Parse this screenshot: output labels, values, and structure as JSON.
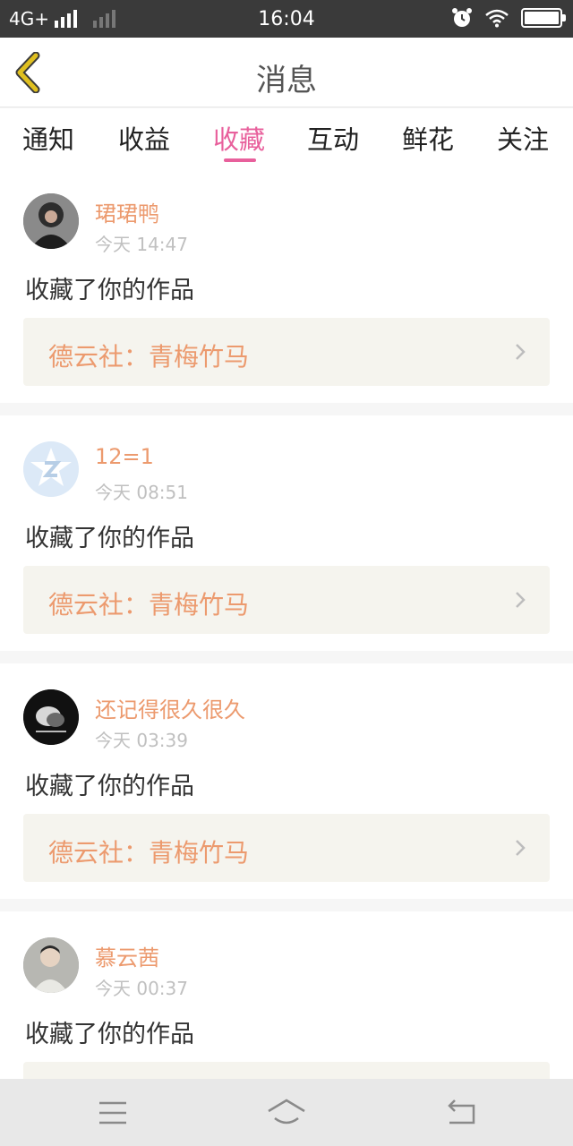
{
  "status_bar": {
    "network": "4G+",
    "time": "16:04",
    "icons": [
      "signal-icon",
      "signal-weak-icon",
      "alarm-icon",
      "wifi-icon",
      "battery-icon"
    ]
  },
  "header": {
    "title": "消息",
    "back_icon": "chevron-left-icon"
  },
  "tabs": [
    {
      "label": "通知",
      "active": false
    },
    {
      "label": "收益",
      "active": false
    },
    {
      "label": "收藏",
      "active": true
    },
    {
      "label": "互动",
      "active": false
    },
    {
      "label": "鲜花",
      "active": false
    },
    {
      "label": "关注",
      "active": false
    }
  ],
  "items": [
    {
      "username": "珺珺鸭",
      "time": "今天 14:47",
      "action": "收藏了你的作品",
      "work_title": "德云社：青梅竹马"
    },
    {
      "username": "12=1",
      "time": "今天 08:51",
      "action": "收藏了你的作品",
      "work_title": "德云社：青梅竹马"
    },
    {
      "username": "还记得很久很久",
      "time": "今天 03:39",
      "action": "收藏了你的作品",
      "work_title": "德云社：青梅竹马"
    },
    {
      "username": "慕云茜",
      "time": "今天 00:37",
      "action": "收藏了你的作品",
      "work_title": ""
    }
  ],
  "nav_bar": {
    "icons": [
      "menu-icon",
      "home-icon",
      "back-icon"
    ]
  },
  "colors": {
    "accent": "#e8609c",
    "username": "#ec9a6e",
    "work_title": "#ec9a6e",
    "back_chevron": "#e0c020",
    "status_bar_bg": "#3a3a3a"
  }
}
